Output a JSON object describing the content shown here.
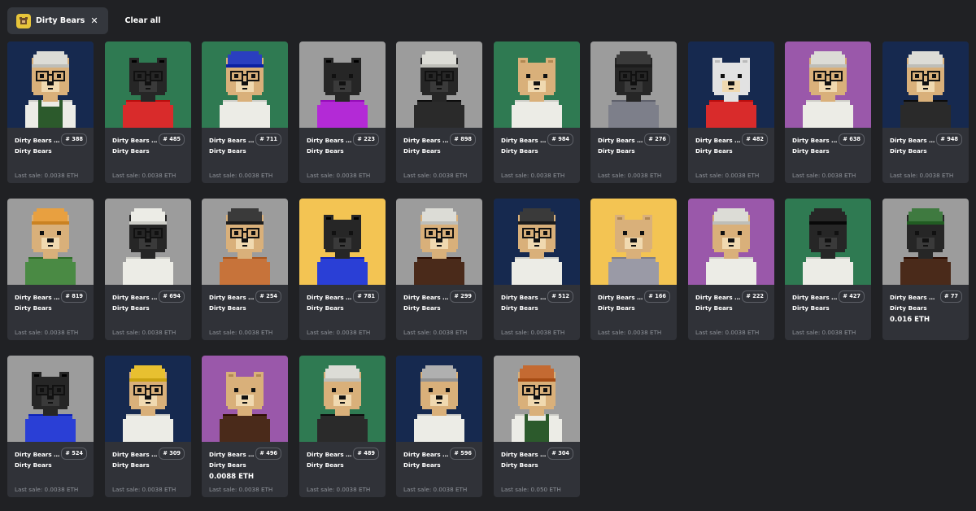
{
  "filter": {
    "chip_label": "Dirty Bears",
    "chip_close": "✕",
    "clear_all": "Clear all"
  },
  "cards": [
    {
      "name": "Dirty Bears ...",
      "number": "# 388",
      "collection": "Dirty Bears",
      "price": "",
      "last_sale": "Last sale: 0.0038 ETH",
      "bg": "#16294f",
      "fur": "#d9b07a",
      "shirt": "#ecece6",
      "hat": "#dcdcd6",
      "glasses": true,
      "overalls": "#2c5a2c"
    },
    {
      "name": "Dirty Bears ...",
      "number": "# 485",
      "collection": "Dirty Bears",
      "price": "",
      "last_sale": "Last sale: 0.0038 ETH",
      "bg": "#2f7a52",
      "fur": "#262626",
      "shirt": "#d92b2b",
      "hat": "",
      "glasses": true,
      "overalls": ""
    },
    {
      "name": "Dirty Bears #...",
      "number": "# 711",
      "collection": "Dirty Bears",
      "price": "",
      "last_sale": "Last sale: 0.0038 ETH",
      "bg": "#2f7a52",
      "fur": "#d9b07a",
      "shirt": "#ecece6",
      "hat": "#2a3fc0",
      "glasses": true,
      "overalls": ""
    },
    {
      "name": "Dirty Bears ...",
      "number": "# 223",
      "collection": "Dirty Bears",
      "price": "",
      "last_sale": "Last sale: 0.0038 ETH",
      "bg": "#9c9c9c",
      "fur": "#262626",
      "shirt": "#b32ad6",
      "hat": "",
      "glasses": false,
      "overalls": ""
    },
    {
      "name": "Dirty Bears ...",
      "number": "# 898",
      "collection": "Dirty Bears",
      "price": "",
      "last_sale": "Last sale: 0.0038 ETH",
      "bg": "#9c9c9c",
      "fur": "#262626",
      "shirt": "#2a2a2a",
      "hat": "#dcdcd6",
      "glasses": true,
      "overalls": ""
    },
    {
      "name": "Dirty Bears ...",
      "number": "# 984",
      "collection": "Dirty Bears",
      "price": "",
      "last_sale": "Last sale: 0.0038 ETH",
      "bg": "#2f7a52",
      "fur": "#d9b07a",
      "shirt": "#ecece6",
      "hat": "",
      "glasses": false,
      "overalls": ""
    },
    {
      "name": "Dirty Bears ...",
      "number": "# 276",
      "collection": "Dirty Bears",
      "price": "",
      "last_sale": "Last sale: 0.0038 ETH",
      "bg": "#9c9c9c",
      "fur": "#262626",
      "shirt": "#7d7f8a",
      "hat": "#3a3a3a",
      "glasses": true,
      "overalls": ""
    },
    {
      "name": "Dirty Bears ...",
      "number": "# 482",
      "collection": "Dirty Bears",
      "price": "",
      "last_sale": "Last sale: 0.0038 ETH",
      "bg": "#16294f",
      "fur": "#e2e2e2",
      "shirt": "#d92b2b",
      "hat": "",
      "glasses": false,
      "overalls": ""
    },
    {
      "name": "Dirty Bears ...",
      "number": "# 638",
      "collection": "Dirty Bears",
      "price": "",
      "last_sale": "Last sale: 0.0038 ETH",
      "bg": "#9a58aa",
      "fur": "#d9b07a",
      "shirt": "#ecece6",
      "hat": "#dcdcd6",
      "glasses": true,
      "overalls": ""
    },
    {
      "name": "Dirty Bears ...",
      "number": "# 948",
      "collection": "Dirty Bears",
      "price": "",
      "last_sale": "Last sale: 0.0038 ETH",
      "bg": "#16294f",
      "fur": "#d9b07a",
      "shirt": "#2a2a2a",
      "hat": "#dcdcd6",
      "glasses": true,
      "overalls": ""
    },
    {
      "name": "Dirty Bears ...",
      "number": "# 819",
      "collection": "Dirty Bears",
      "price": "",
      "last_sale": "Last sale: 0.0038 ETH",
      "bg": "#9c9c9c",
      "fur": "#d9b07a",
      "shirt": "#4a8a44",
      "hat": "#e8a040",
      "glasses": false,
      "overalls": ""
    },
    {
      "name": "Dirty Bears ...",
      "number": "# 694",
      "collection": "Dirty Bears",
      "price": "",
      "last_sale": "Last sale: 0.0038 ETH",
      "bg": "#9c9c9c",
      "fur": "#262626",
      "shirt": "#ecece6",
      "hat": "#ecece6",
      "glasses": true,
      "overalls": ""
    },
    {
      "name": "Dirty Bears ...",
      "number": "# 254",
      "collection": "Dirty Bears",
      "price": "",
      "last_sale": "Last sale: 0.0038 ETH",
      "bg": "#9c9c9c",
      "fur": "#d9b07a",
      "shirt": "#c7733a",
      "hat": "#3a3a3a",
      "glasses": true,
      "overalls": ""
    },
    {
      "name": "Dirty Bears ...",
      "number": "# 781",
      "collection": "Dirty Bears",
      "price": "",
      "last_sale": "Last sale: 0.0038 ETH",
      "bg": "#f3c453",
      "fur": "#262626",
      "shirt": "#2a3fd6",
      "hat": "",
      "glasses": false,
      "overalls": ""
    },
    {
      "name": "Dirty Bears ...",
      "number": "# 299",
      "collection": "Dirty Bears",
      "price": "",
      "last_sale": "Last sale: 0.0038 ETH",
      "bg": "#9c9c9c",
      "fur": "#d9b07a",
      "shirt": "#4a2a1a",
      "hat": "#dcdcd6",
      "glasses": true,
      "overalls": ""
    },
    {
      "name": "Dirty Bears ...",
      "number": "# 512",
      "collection": "Dirty Bears",
      "price": "",
      "last_sale": "Last sale: 0.0038 ETH",
      "bg": "#16294f",
      "fur": "#d9b07a",
      "shirt": "#ecece6",
      "hat": "#3a3a3a",
      "glasses": true,
      "overalls": ""
    },
    {
      "name": "Dirty Bears ...",
      "number": "# 166",
      "collection": "Dirty Bears",
      "price": "",
      "last_sale": "Last sale: 0.0038 ETH",
      "bg": "#f3c453",
      "fur": "#d9b07a",
      "shirt": "#9a9aa6",
      "hat": "",
      "glasses": false,
      "overalls": ""
    },
    {
      "name": "Dirty Bears ...",
      "number": "# 222",
      "collection": "Dirty Bears",
      "price": "",
      "last_sale": "Last sale: 0.0038 ETH",
      "bg": "#9a58aa",
      "fur": "#d9b07a",
      "shirt": "#ecece6",
      "hat": "#dcdcd6",
      "glasses": false,
      "overalls": ""
    },
    {
      "name": "Dirty Bears ...",
      "number": "# 427",
      "collection": "Dirty Bears",
      "price": "",
      "last_sale": "Last sale: 0.0038 ETH",
      "bg": "#2f7a52",
      "fur": "#262626",
      "shirt": "#ecece6",
      "hat": "#262626",
      "glasses": false,
      "overalls": ""
    },
    {
      "name": "Dirty Bears #...",
      "number": "# 77",
      "collection": "Dirty Bears",
      "price": "0.016 ETH",
      "last_sale": "",
      "bg": "#9c9c9c",
      "fur": "#262626",
      "shirt": "#4a2a1a",
      "hat": "#3f7a40",
      "glasses": false,
      "overalls": ""
    },
    {
      "name": "Dirty Bears ...",
      "number": "# 524",
      "collection": "Dirty Bears",
      "price": "",
      "last_sale": "Last sale: 0.0038 ETH",
      "bg": "#9c9c9c",
      "fur": "#262626",
      "shirt": "#2a3fd6",
      "hat": "",
      "glasses": true,
      "overalls": ""
    },
    {
      "name": "Dirty Bears ...",
      "number": "# 309",
      "collection": "Dirty Bears",
      "price": "",
      "last_sale": "Last sale: 0.0038 ETH",
      "bg": "#16294f",
      "fur": "#d9b07a",
      "shirt": "#ecece6",
      "hat": "#e8c030",
      "glasses": true,
      "overalls": ""
    },
    {
      "name": "Dirty Bears ...",
      "number": "# 496",
      "collection": "Dirty Bears",
      "price": "0.0088 ETH",
      "last_sale": "Last sale: 0.0038 ETH",
      "bg": "#9a58aa",
      "fur": "#d9b07a",
      "shirt": "#4a2a1a",
      "hat": "",
      "glasses": false,
      "overalls": ""
    },
    {
      "name": "Dirty Bears ...",
      "number": "# 489",
      "collection": "Dirty Bears",
      "price": "",
      "last_sale": "Last sale: 0.0038 ETH",
      "bg": "#2f7a52",
      "fur": "#d9b07a",
      "shirt": "#2a2a2a",
      "hat": "#dcdcd6",
      "glasses": false,
      "overalls": ""
    },
    {
      "name": "Dirty Bears ...",
      "number": "# 596",
      "collection": "Dirty Bears",
      "price": "",
      "last_sale": "Last sale: 0.0038 ETH",
      "bg": "#16294f",
      "fur": "#d9b07a",
      "shirt": "#ecece6",
      "hat": "#b0b0b0",
      "glasses": false,
      "overalls": ""
    },
    {
      "name": "Dirty Bears ...",
      "number": "# 304",
      "collection": "Dirty Bears",
      "price": "",
      "last_sale": "Last sale: 0.050 ETH",
      "bg": "#9c9c9c",
      "fur": "#d9b07a",
      "shirt": "#ecece6",
      "hat": "#c46a32",
      "glasses": true,
      "overalls": "#2c5a2c"
    }
  ]
}
